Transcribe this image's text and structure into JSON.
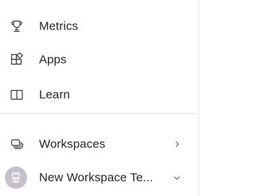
{
  "nav": {
    "items": [
      {
        "label": "Metrics",
        "icon": "trophy-icon"
      },
      {
        "label": "Apps",
        "icon": "apps-icon"
      },
      {
        "label": "Learn",
        "icon": "book-icon"
      }
    ]
  },
  "workspaces": {
    "label": "Workspaces",
    "icon": "workspaces-icon",
    "chevron": "chevron-right-icon"
  },
  "current_workspace": {
    "label": "New Workspace Te...",
    "icon": "workspace-avatar",
    "chevron": "chevron-down-icon"
  },
  "colors": {
    "text": "#242424",
    "icon": "#424242",
    "divider": "#e1e1e1",
    "avatar_bg": "#c7c1cb"
  }
}
